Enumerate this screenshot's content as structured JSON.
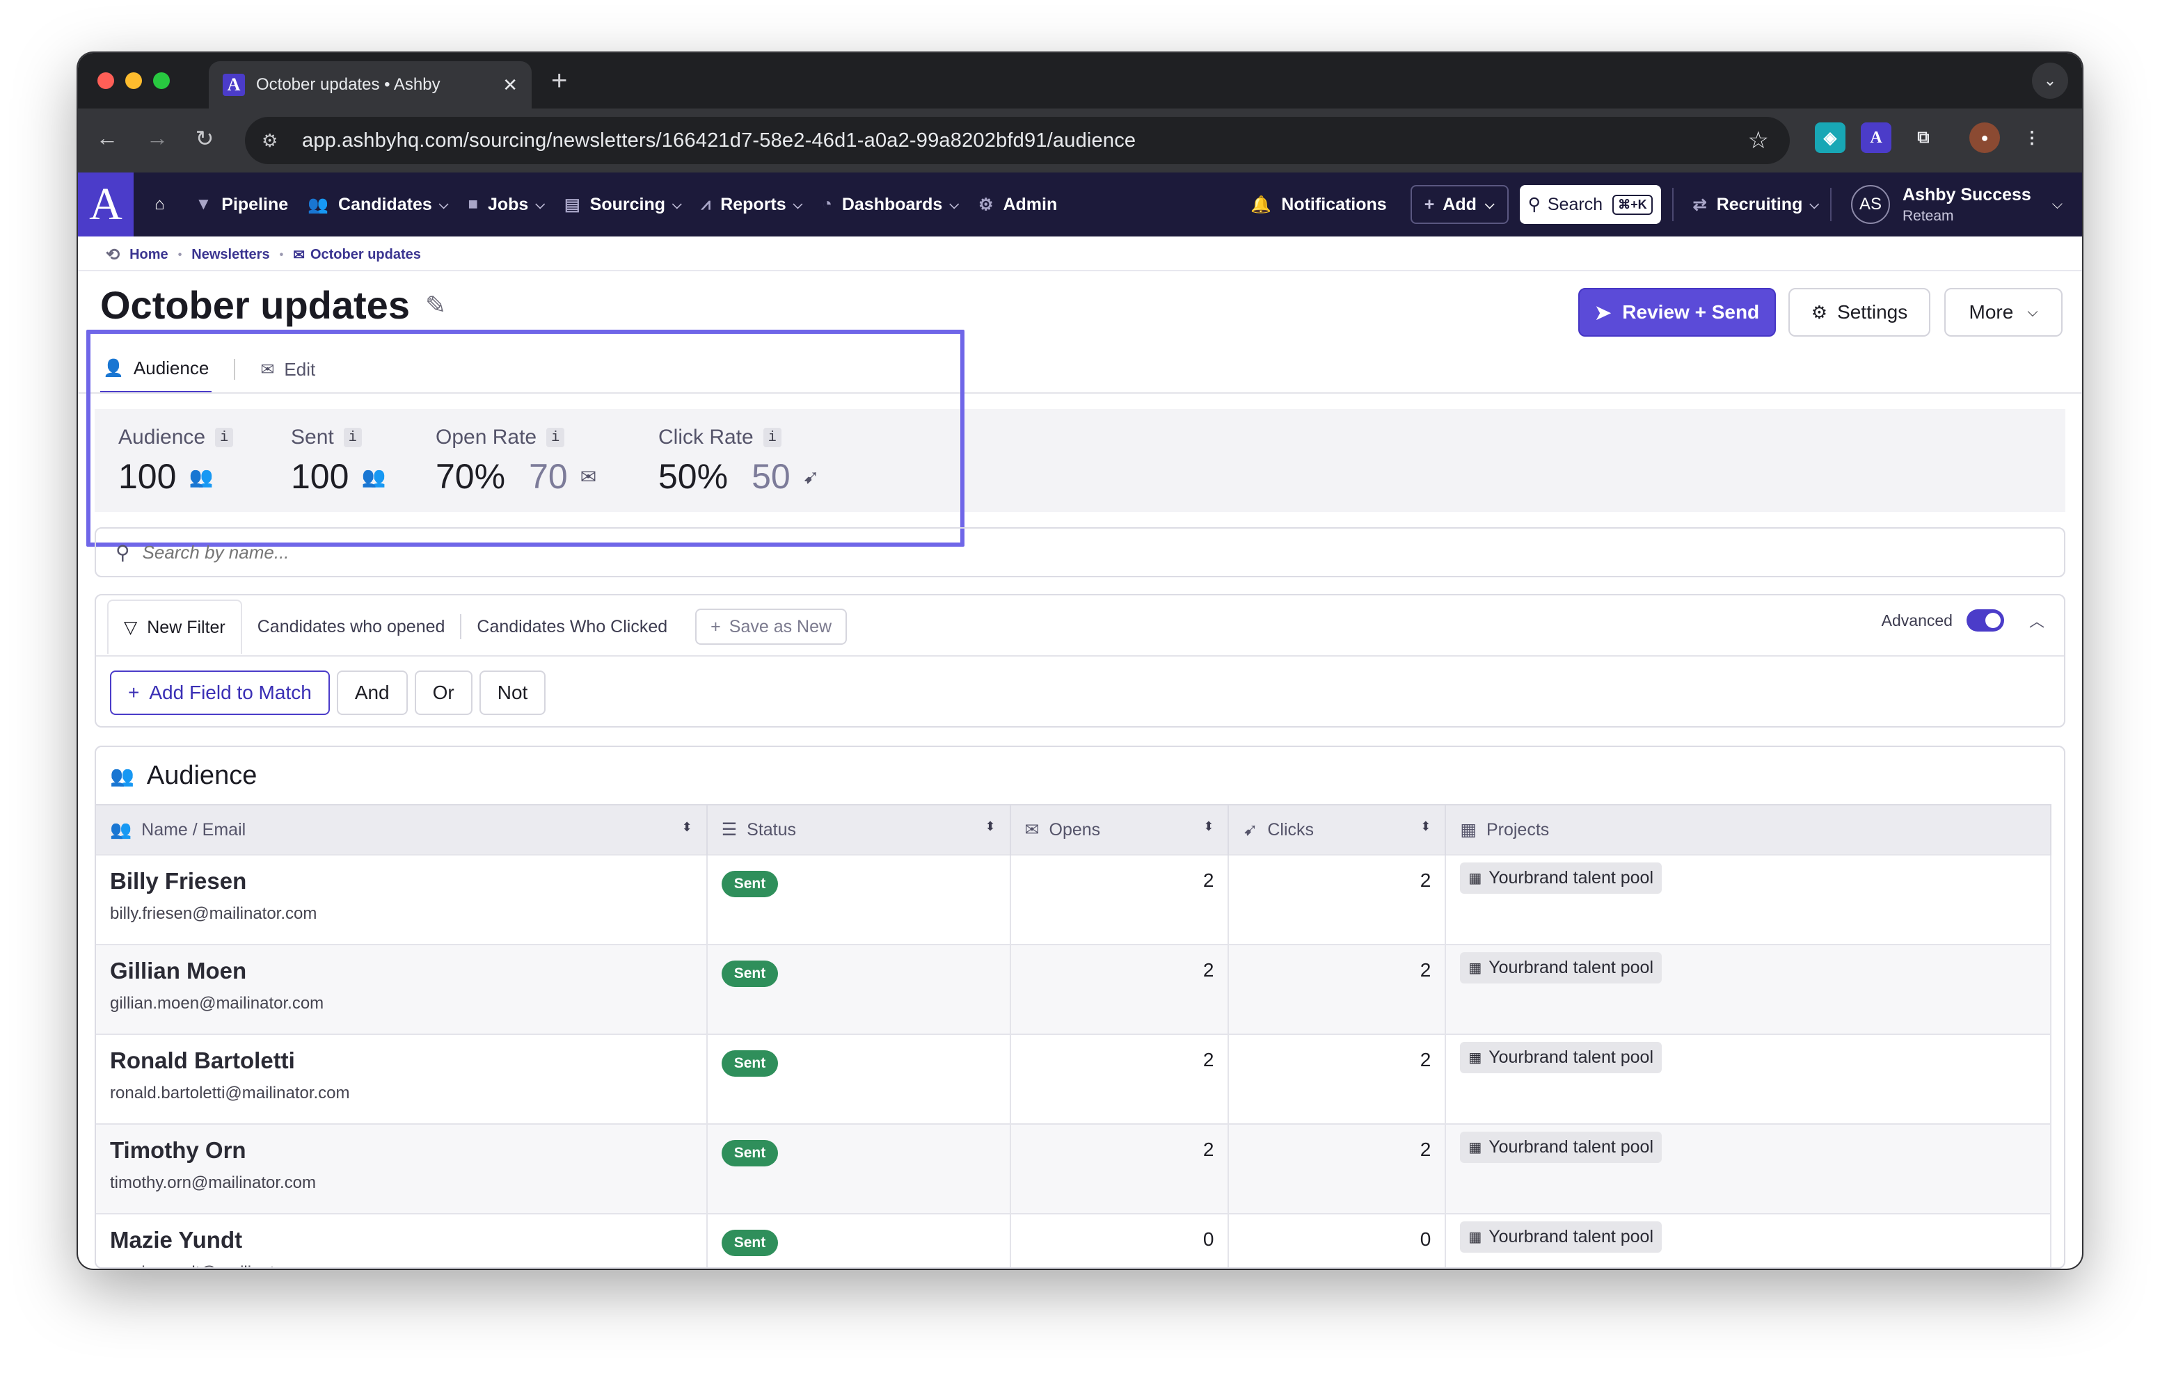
{
  "browser": {
    "tab_title": "October updates • Ashby",
    "favicon_letter": "A",
    "url": "app.ashbyhq.com/sourcing/newsletters/166421d7-58e2-46d1-a0a2-99a8202bfd91/audience"
  },
  "nav": {
    "logo": "A",
    "items": [
      {
        "label": "Pipeline",
        "icon": "filter-icon"
      },
      {
        "label": "Candidates",
        "icon": "people-icon"
      },
      {
        "label": "Jobs",
        "icon": "briefcase-icon"
      },
      {
        "label": "Sourcing",
        "icon": "inbox-icon"
      },
      {
        "label": "Reports",
        "icon": "chart-icon"
      },
      {
        "label": "Dashboards",
        "icon": "gauge-icon"
      },
      {
        "label": "Admin",
        "icon": "gear-icon"
      }
    ],
    "notifications": "Notifications",
    "add": "Add",
    "search": "Search",
    "search_shortcut": "⌘+K",
    "recruiting": "Recruiting",
    "avatar_initials": "AS",
    "user_name": "Ashby Success",
    "user_org": "Reteam"
  },
  "breadcrumbs": [
    "Home",
    "Newsletters",
    "October updates"
  ],
  "page": {
    "title": "October updates",
    "review_send": "Review + Send",
    "settings": "Settings",
    "more": "More"
  },
  "tabs": [
    "Audience",
    "Edit"
  ],
  "stats": [
    {
      "label": "Audience",
      "value": "100",
      "sub": ""
    },
    {
      "label": "Sent",
      "value": "100",
      "sub": ""
    },
    {
      "label": "Open Rate",
      "value": "70%",
      "sub": "70"
    },
    {
      "label": "Click Rate",
      "value": "50%",
      "sub": "50"
    }
  ],
  "search": {
    "placeholder": "Search by name..."
  },
  "filters": {
    "tabs": [
      "New Filter",
      "Candidates who opened",
      "Candidates Who Clicked"
    ],
    "save_as_new": "Save as New",
    "advanced": "Advanced",
    "advanced_on": true,
    "add_field": "Add Field to Match",
    "and": "And",
    "or": "Or",
    "not": "Not"
  },
  "audience": {
    "heading": "Audience",
    "columns": [
      "Name / Email",
      "Status",
      "Opens",
      "Clicks",
      "Projects"
    ],
    "rows": [
      {
        "name": "Billy Friesen",
        "email": "billy.friesen@mailinator.com",
        "status": "Sent",
        "opens": "2",
        "clicks": "2",
        "project": "Yourbrand talent pool"
      },
      {
        "name": "Gillian Moen",
        "email": "gillian.moen@mailinator.com",
        "status": "Sent",
        "opens": "2",
        "clicks": "2",
        "project": "Yourbrand talent pool"
      },
      {
        "name": "Ronald Bartoletti",
        "email": "ronald.bartoletti@mailinator.com",
        "status": "Sent",
        "opens": "2",
        "clicks": "2",
        "project": "Yourbrand talent pool"
      },
      {
        "name": "Timothy Orn",
        "email": "timothy.orn@mailinator.com",
        "status": "Sent",
        "opens": "2",
        "clicks": "2",
        "project": "Yourbrand talent pool"
      },
      {
        "name": "Mazie Yundt",
        "email": "mazie.yundt@mailinator.com",
        "status": "Sent",
        "opens": "0",
        "clicks": "0",
        "project": "Yourbrand talent pool"
      }
    ]
  },
  "colors": {
    "accent": "#4b3cc9",
    "nav_bg": "#1c1a3a",
    "sent_badge": "#2f8f5b",
    "highlight": "#6f66e8"
  }
}
